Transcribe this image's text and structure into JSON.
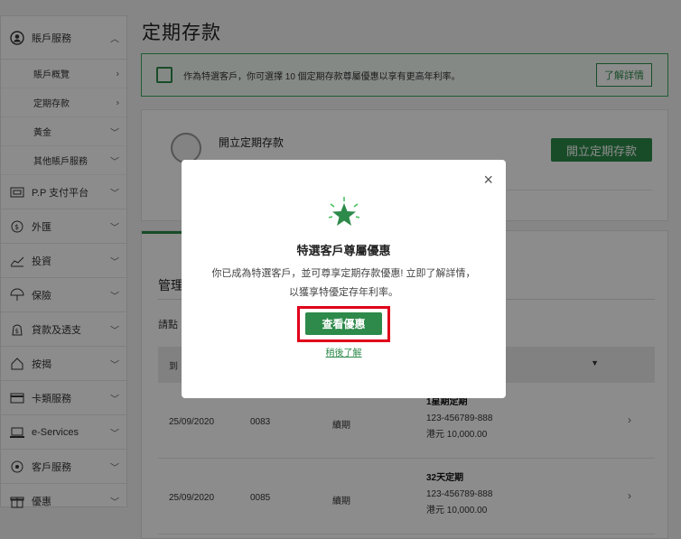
{
  "sidebar": {
    "account": {
      "label": "賬戶服務",
      "icon": "user-icon"
    },
    "sub_items": [
      {
        "label": "賬戶概覽"
      },
      {
        "label": "定期存款"
      },
      {
        "label": "黃金"
      },
      {
        "label": "其他賬戶服務"
      }
    ],
    "items": [
      {
        "label": "P.P 支付平台",
        "icon": "payment-icon"
      },
      {
        "label": "外匯",
        "icon": "fx-icon"
      },
      {
        "label": "投資",
        "icon": "chart-icon"
      },
      {
        "label": "保險",
        "icon": "umbrella-icon"
      },
      {
        "label": "貸款及透支",
        "icon": "loan-icon"
      },
      {
        "label": "按揭",
        "icon": "house-icon"
      },
      {
        "label": "卡類服務",
        "icon": "card-icon"
      },
      {
        "label": "e-Services",
        "icon": "laptop-icon"
      },
      {
        "label": "客戶服務",
        "icon": "support-icon"
      },
      {
        "label": "優惠",
        "icon": "gift-icon"
      }
    ]
  },
  "page_title": "定期存款",
  "banner": {
    "text": "作為特選客戶，你可選擇 10 個定期存款尊屬優惠以享有更高年利率。",
    "button": "了解詳情"
  },
  "card": {
    "title": "開立定期存款",
    "button": "開立定期存款"
  },
  "panel": {
    "title": "管理",
    "subtitle": "請點",
    "th_first": "到",
    "rows": [
      {
        "date": "25/09/2020",
        "code": "0083",
        "status": "續期",
        "plan": "1星期定期",
        "account": "123-456789-888",
        "amount": "港元 10,000.00"
      },
      {
        "date": "25/09/2020",
        "code": "0085",
        "status": "續期",
        "plan": "32天定期",
        "account": "123-456789-888",
        "amount": "港元 10,000.00"
      }
    ]
  },
  "modal": {
    "title": "特選客戶尊屬優惠",
    "body": "你已成為特選客戶，並可尊享定期存款優惠! 立即了解詳情，以獲享特優定存年利率。",
    "primary_button": "查看優惠",
    "secondary_link": "稍後了解",
    "close": "×"
  },
  "colors": {
    "accent": "#2d8a4a",
    "highlight": "#e0001b"
  }
}
